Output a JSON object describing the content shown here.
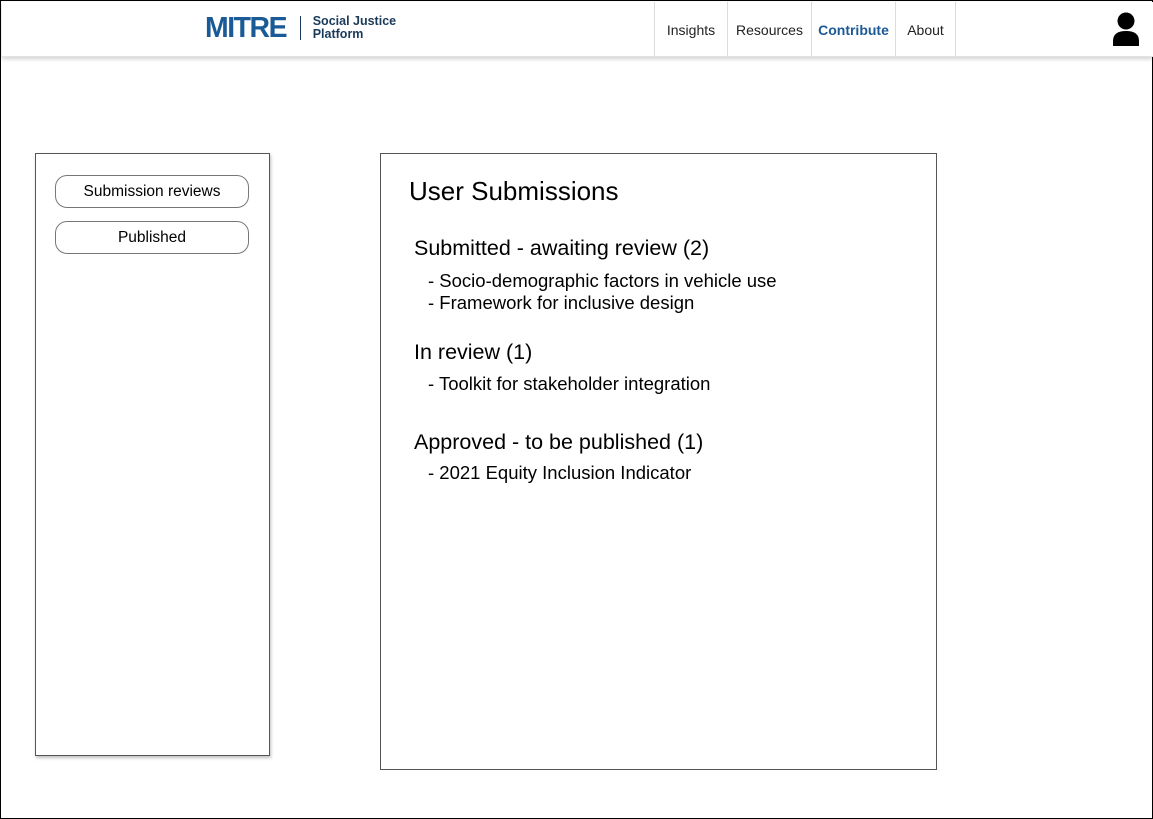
{
  "header": {
    "logo": {
      "mark": "MITRE",
      "subtitle_line1": "Social Justice",
      "subtitle_line2": "Platform",
      "brand_color": "#1a5a96"
    },
    "nav": [
      {
        "label": "Insights",
        "active": false
      },
      {
        "label": "Resources",
        "active": false
      },
      {
        "label": "Contribute",
        "active": true
      },
      {
        "label": "About",
        "active": false
      }
    ],
    "user_icon": "user-icon",
    "active_color": "#1b5a96"
  },
  "sidebar": {
    "buttons": [
      {
        "label": "Submission reviews"
      },
      {
        "label": "Published"
      }
    ]
  },
  "main": {
    "title": "User Submissions",
    "sections": [
      {
        "title": "Submitted - awaiting review (2)",
        "items": [
          "- Socio-demographic factors in vehicle use",
          "- Framework for inclusive design"
        ]
      },
      {
        "title": "In review (1)",
        "items": [
          "- Toolkit for stakeholder integration"
        ]
      },
      {
        "title": "Approved - to be published (1)",
        "items": [
          "- 2021 Equity Inclusion Indicator"
        ]
      }
    ]
  }
}
